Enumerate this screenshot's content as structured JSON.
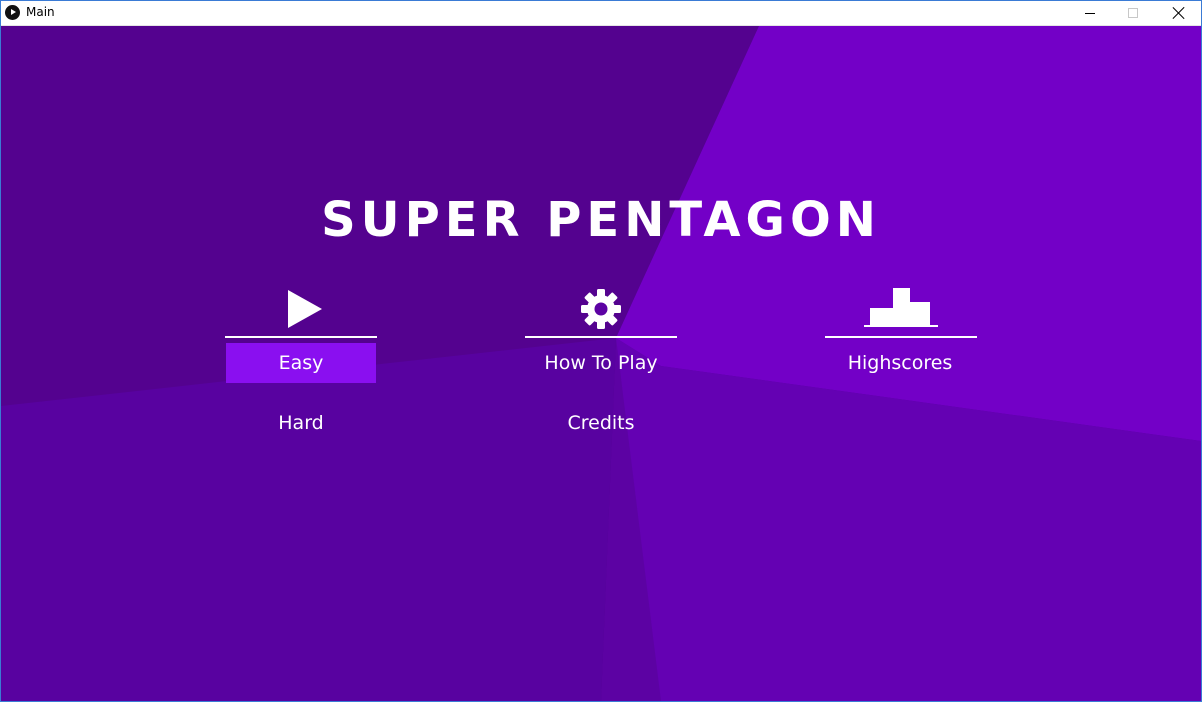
{
  "window": {
    "title": "Main"
  },
  "game": {
    "title": "SUPER PENTAGON",
    "colors": {
      "background_dark": "#5c02a3",
      "background_mid": "#52028f",
      "background_light": "#7300c7",
      "selected_item": "#8a0ff0",
      "text": "#ffffff"
    },
    "columns": [
      {
        "icon": "play-icon",
        "items": [
          "Easy",
          "Hard"
        ],
        "selected": "Easy"
      },
      {
        "icon": "gear-icon",
        "items": [
          "How To Play",
          "Credits"
        ]
      },
      {
        "icon": "podium-icon",
        "items": [
          "Highscores"
        ]
      }
    ],
    "menu": {
      "easy": "Easy",
      "hard": "Hard",
      "how_to_play": "How To Play",
      "credits": "Credits",
      "highscores": "Highscores"
    }
  }
}
